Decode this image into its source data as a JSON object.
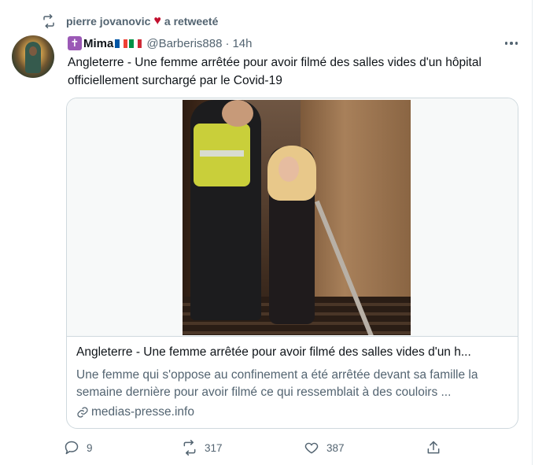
{
  "retweet": {
    "user": "pierre jovanovic",
    "heart": "♥",
    "action": "a retweeté"
  },
  "tweet": {
    "display_name": "Mima",
    "handle": "@Barberis888",
    "separator": "·",
    "time": "14h",
    "text": "Angleterre - Une femme arrêtée pour avoir filmé des salles vides d'un hôpital officiellement surchargé par le Covid-19"
  },
  "card": {
    "title": "Angleterre - Une femme arrêtée pour avoir filmé des salles vides d'un h...",
    "description": "Une femme qui s'oppose au confinement a été arrêtée devant sa famille la semaine dernière pour avoir filmé ce qui ressemblait à des couloirs ...",
    "domain": "medias-presse.info"
  },
  "actions": {
    "reply_count": "9",
    "retweet_count": "317",
    "like_count": "387"
  },
  "colors": {
    "muted": "#536471",
    "border": "#cfd9de",
    "heart": "#c2102e",
    "cross_badge": "#9b59b6"
  },
  "icons": [
    "retweet-icon",
    "heart-icon",
    "cross-emoji-icon",
    "france-flag-icon",
    "italy-flag-icon",
    "more-icon",
    "link-icon",
    "reply-icon",
    "like-icon",
    "share-icon"
  ]
}
